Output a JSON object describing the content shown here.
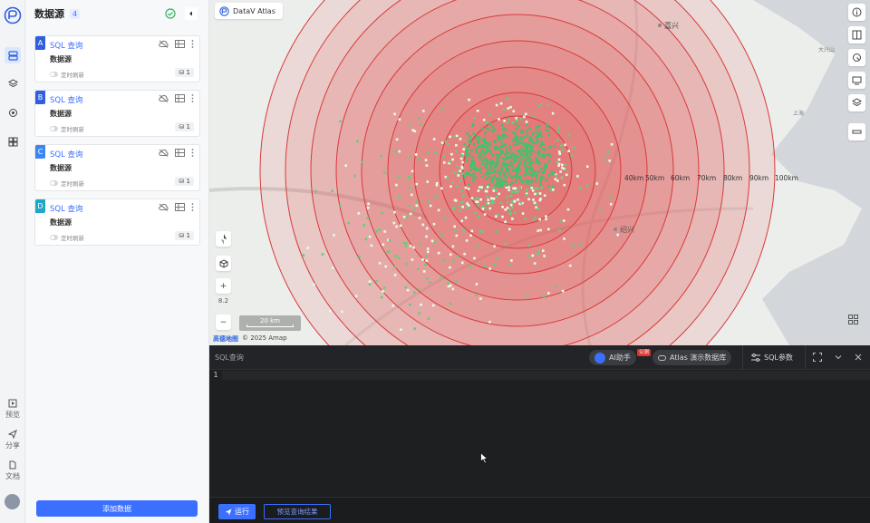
{
  "nav": {
    "preview": "预览",
    "share": "分享",
    "docs": "文档"
  },
  "panel": {
    "title": "数据源",
    "count": "4",
    "cards": [
      {
        "letter": "A",
        "color": "#2f5fe0",
        "query": "SQL 查询",
        "source": "数据源",
        "timer": "定时刷新",
        "count": "1"
      },
      {
        "letter": "B",
        "color": "#2f5fe0",
        "query": "SQL 查询",
        "source": "数据源",
        "timer": "定时刷新",
        "count": "1"
      },
      {
        "letter": "C",
        "color": "#3b86f0",
        "query": "SQL 查询",
        "source": "数据源",
        "timer": "定时刷新",
        "count": "1"
      },
      {
        "letter": "D",
        "color": "#1ea7c8",
        "query": "SQL 查询",
        "source": "数据源",
        "timer": "定时刷新",
        "count": "1"
      }
    ],
    "add_button": "添加数据"
  },
  "map": {
    "brand": "DataV Atlas",
    "cities": [
      "嘉兴",
      "绍兴",
      "大兴山",
      "上海"
    ],
    "ring_labels": [
      "40km",
      "50km",
      "60km",
      "70km",
      "80km",
      "90km",
      "100km"
    ],
    "zoom_level": "8.2",
    "scale_label": "20 km",
    "provider": "高德地图",
    "copyright": "© 2025 Amap",
    "accent_color": "#e34a4a",
    "hex_color": "#5fd17a"
  },
  "sql": {
    "title": "SQL查询",
    "ai_helper": "AI助手",
    "beta_badge": "公测",
    "db_label": "Atlas 演示数据库",
    "sql_params": "SQL参数",
    "line_number": "1",
    "run_button": "运行",
    "preview_button": "预览查询结果"
  }
}
